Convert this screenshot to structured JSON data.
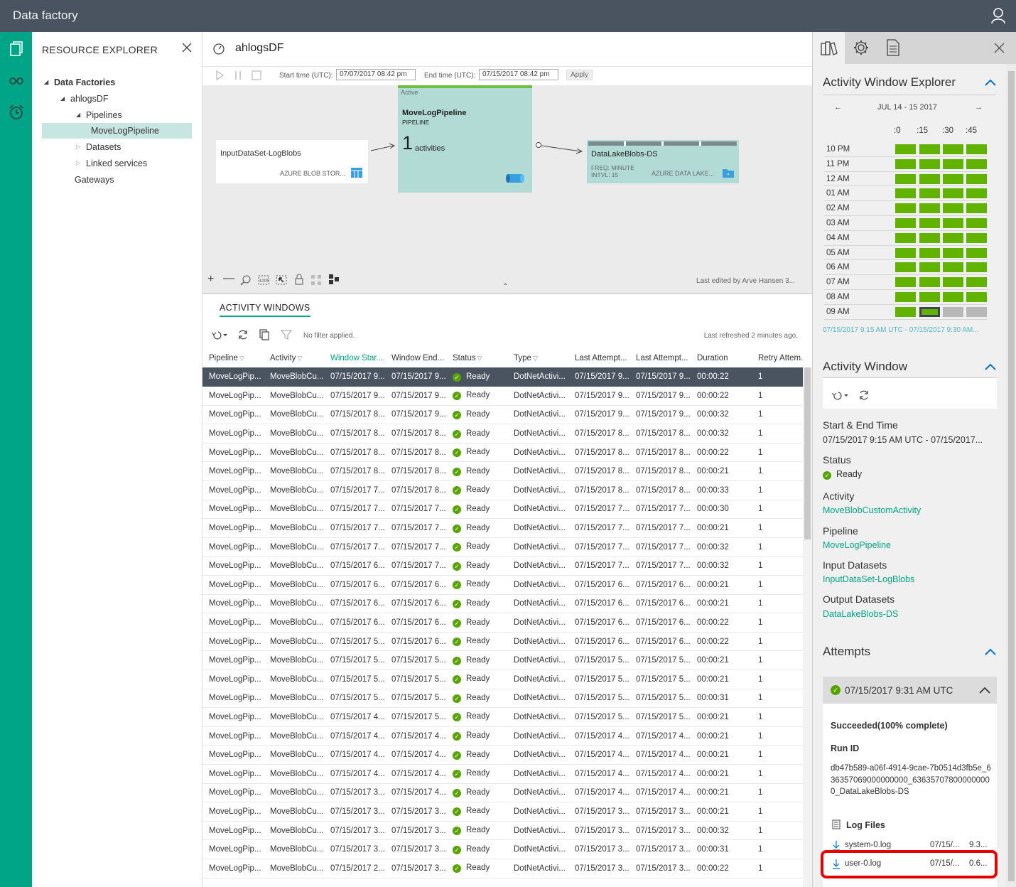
{
  "app": {
    "title": "Data factory"
  },
  "explorer": {
    "header": "RESOURCE EXPLORER",
    "tree": [
      {
        "label": "Data Factories",
        "bold": true
      },
      {
        "label": "ahlogsDF"
      },
      {
        "label": "Pipelines"
      },
      {
        "label": "MoveLogPipeline",
        "selected": true
      },
      {
        "label": "Datasets"
      },
      {
        "label": "Linked services"
      },
      {
        "label": "Gateways"
      }
    ]
  },
  "main": {
    "title": "ahlogsDF",
    "toolbar": {
      "start_label": "Start time (UTC):",
      "start_value": "07/07/2017 08:42 pm",
      "end_label": "End time (UTC):",
      "end_value": "07/15/2017 08:42 pm",
      "apply": "Apply"
    },
    "diagram": {
      "input_node": {
        "name": "InputDataSet-LogBlobs",
        "type": "AZURE BLOB STOR..."
      },
      "pipeline_node": {
        "state": "Active",
        "name": "MoveLogPipeline",
        "kind": "PIPELINE",
        "count": "1",
        "count_label": "activities"
      },
      "output_node": {
        "name": "DataLakeBlobs-DS",
        "freq": "FREQ: MINUTE",
        "intvl": "INTVL: 15",
        "type": "AZURE DATA LAKE..."
      }
    },
    "last_edited": "Last edited by Arve Hansen 3...",
    "activity_windows": {
      "title": "ACTIVITY WINDOWS",
      "filter_text": "No filter applied.",
      "refreshed": "Last refreshed 2 minutes ago.",
      "columns": [
        "Pipeline",
        "Activity",
        "Window Star...",
        "Window End...",
        "Status",
        "Type",
        "Last Attempt...",
        "Last Attempt...",
        "Duration",
        "Retry Attem..."
      ],
      "rows": [
        [
          "MoveLogPip...",
          "MoveBlobCu...",
          "07/15/2017 9...",
          "07/15/2017 9...",
          "Ready",
          "DotNetActivi...",
          "07/15/2017 9...",
          "07/15/2017 9...",
          "00:00:22",
          "1"
        ],
        [
          "MoveLogPip...",
          "MoveBlobCu...",
          "07/15/2017 9...",
          "07/15/2017 9...",
          "Ready",
          "DotNetActivi...",
          "07/15/2017 9...",
          "07/15/2017 9...",
          "00:00:22",
          "1"
        ],
        [
          "MoveLogPip...",
          "MoveBlobCu...",
          "07/15/2017 8...",
          "07/15/2017 9...",
          "Ready",
          "DotNetActivi...",
          "07/15/2017 9...",
          "07/15/2017 9...",
          "00:00:32",
          "1"
        ],
        [
          "MoveLogPip...",
          "MoveBlobCu...",
          "07/15/2017 8...",
          "07/15/2017 8...",
          "Ready",
          "DotNetActivi...",
          "07/15/2017 8...",
          "07/15/2017 8...",
          "00:00:32",
          "1"
        ],
        [
          "MoveLogPip...",
          "MoveBlobCu...",
          "07/15/2017 8...",
          "07/15/2017 8...",
          "Ready",
          "DotNetActivi...",
          "07/15/2017 8...",
          "07/15/2017 8...",
          "00:00:22",
          "1"
        ],
        [
          "MoveLogPip...",
          "MoveBlobCu...",
          "07/15/2017 8...",
          "07/15/2017 8...",
          "Ready",
          "DotNetActivi...",
          "07/15/2017 8...",
          "07/15/2017 8...",
          "00:00:21",
          "1"
        ],
        [
          "MoveLogPip...",
          "MoveBlobCu...",
          "07/15/2017 7...",
          "07/15/2017 8...",
          "Ready",
          "DotNetActivi...",
          "07/15/2017 8...",
          "07/15/2017 8...",
          "00:00:33",
          "1"
        ],
        [
          "MoveLogPip...",
          "MoveBlobCu...",
          "07/15/2017 7...",
          "07/15/2017 7...",
          "Ready",
          "DotNetActivi...",
          "07/15/2017 7...",
          "07/15/2017 7...",
          "00:00:30",
          "1"
        ],
        [
          "MoveLogPip...",
          "MoveBlobCu...",
          "07/15/2017 7...",
          "07/15/2017 7...",
          "Ready",
          "DotNetActivi...",
          "07/15/2017 7...",
          "07/15/2017 7...",
          "00:00:21",
          "1"
        ],
        [
          "MoveLogPip...",
          "MoveBlobCu...",
          "07/15/2017 7...",
          "07/15/2017 7...",
          "Ready",
          "DotNetActivi...",
          "07/15/2017 7...",
          "07/15/2017 7...",
          "00:00:32",
          "1"
        ],
        [
          "MoveLogPip...",
          "MoveBlobCu...",
          "07/15/2017 6...",
          "07/15/2017 7...",
          "Ready",
          "DotNetActivi...",
          "07/15/2017 7...",
          "07/15/2017 7...",
          "00:00:32",
          "1"
        ],
        [
          "MoveLogPip...",
          "MoveBlobCu...",
          "07/15/2017 6...",
          "07/15/2017 6...",
          "Ready",
          "DotNetActivi...",
          "07/15/2017 6...",
          "07/15/2017 6...",
          "00:00:21",
          "1"
        ],
        [
          "MoveLogPip...",
          "MoveBlobCu...",
          "07/15/2017 6...",
          "07/15/2017 6...",
          "Ready",
          "DotNetActivi...",
          "07/15/2017 6...",
          "07/15/2017 6...",
          "00:00:21",
          "1"
        ],
        [
          "MoveLogPip...",
          "MoveBlobCu...",
          "07/15/2017 6...",
          "07/15/2017 6...",
          "Ready",
          "DotNetActivi...",
          "07/15/2017 6...",
          "07/15/2017 6...",
          "00:00:22",
          "1"
        ],
        [
          "MoveLogPip...",
          "MoveBlobCu...",
          "07/15/2017 5...",
          "07/15/2017 6...",
          "Ready",
          "DotNetActivi...",
          "07/15/2017 6...",
          "07/15/2017 6...",
          "00:00:22",
          "1"
        ],
        [
          "MoveLogPip...",
          "MoveBlobCu...",
          "07/15/2017 5...",
          "07/15/2017 5...",
          "Ready",
          "DotNetActivi...",
          "07/15/2017 5...",
          "07/15/2017 5...",
          "00:00:21",
          "1"
        ],
        [
          "MoveLogPip...",
          "MoveBlobCu...",
          "07/15/2017 5...",
          "07/15/2017 5...",
          "Ready",
          "DotNetActivi...",
          "07/15/2017 5...",
          "07/15/2017 5...",
          "00:00:21",
          "1"
        ],
        [
          "MoveLogPip...",
          "MoveBlobCu...",
          "07/15/2017 5...",
          "07/15/2017 5...",
          "Ready",
          "DotNetActivi...",
          "07/15/2017 5...",
          "07/15/2017 5...",
          "00:00:31",
          "1"
        ],
        [
          "MoveLogPip...",
          "MoveBlobCu...",
          "07/15/2017 4...",
          "07/15/2017 5...",
          "Ready",
          "DotNetActivi...",
          "07/15/2017 5...",
          "07/15/2017 5...",
          "00:00:21",
          "1"
        ],
        [
          "MoveLogPip...",
          "MoveBlobCu...",
          "07/15/2017 4...",
          "07/15/2017 4...",
          "Ready",
          "DotNetActivi...",
          "07/15/2017 4...",
          "07/15/2017 4...",
          "00:00:21",
          "1"
        ],
        [
          "MoveLogPip...",
          "MoveBlobCu...",
          "07/15/2017 4...",
          "07/15/2017 4...",
          "Ready",
          "DotNetActivi...",
          "07/15/2017 4...",
          "07/15/2017 4...",
          "00:00:21",
          "1"
        ],
        [
          "MoveLogPip...",
          "MoveBlobCu...",
          "07/15/2017 4...",
          "07/15/2017 4...",
          "Ready",
          "DotNetActivi...",
          "07/15/2017 4...",
          "07/15/2017 4...",
          "00:00:21",
          "1"
        ],
        [
          "MoveLogPip...",
          "MoveBlobCu...",
          "07/15/2017 3...",
          "07/15/2017 4...",
          "Ready",
          "DotNetActivi...",
          "07/15/2017 4...",
          "07/15/2017 4...",
          "00:00:21",
          "1"
        ],
        [
          "MoveLogPip...",
          "MoveBlobCu...",
          "07/15/2017 3...",
          "07/15/2017 3...",
          "Ready",
          "DotNetActivi...",
          "07/15/2017 3...",
          "07/15/2017 3...",
          "00:00:21",
          "1"
        ],
        [
          "MoveLogPip...",
          "MoveBlobCu...",
          "07/15/2017 3...",
          "07/15/2017 3...",
          "Ready",
          "DotNetActivi...",
          "07/15/2017 3...",
          "07/15/2017 3...",
          "00:00:32",
          "1"
        ],
        [
          "MoveLogPip...",
          "MoveBlobCu...",
          "07/15/2017 3...",
          "07/15/2017 3...",
          "Ready",
          "DotNetActivi...",
          "07/15/2017 3...",
          "07/15/2017 3...",
          "00:00:31",
          "1"
        ],
        [
          "MoveLogPip...",
          "MoveBlobCu...",
          "07/15/2017 2...",
          "07/15/2017 3...",
          "Ready",
          "DotNetActivi...",
          "07/15/2017 3...",
          "07/15/2017 3...",
          "00:00:22",
          "1"
        ]
      ]
    }
  },
  "right": {
    "explorer_title": "Activity Window Explorer",
    "date_range": "JUL 14 - 15 2017",
    "minute_cols": [
      ":0",
      ":15",
      ":30",
      ":45"
    ],
    "hours": [
      {
        "label": "10 PM",
        "cells": [
          "ready",
          "ready",
          "ready",
          "ready"
        ]
      },
      {
        "label": "11 PM",
        "cells": [
          "ready",
          "ready",
          "ready",
          "ready"
        ]
      },
      {
        "label": "12 AM",
        "cells": [
          "ready",
          "ready",
          "ready",
          "ready"
        ]
      },
      {
        "label": "01 AM",
        "cells": [
          "ready",
          "ready",
          "ready",
          "ready"
        ]
      },
      {
        "label": "02 AM",
        "cells": [
          "ready",
          "ready",
          "ready",
          "ready"
        ]
      },
      {
        "label": "03 AM",
        "cells": [
          "ready",
          "ready",
          "ready",
          "ready"
        ]
      },
      {
        "label": "04 AM",
        "cells": [
          "ready",
          "ready",
          "ready",
          "ready"
        ]
      },
      {
        "label": "05 AM",
        "cells": [
          "ready",
          "ready",
          "ready",
          "ready"
        ]
      },
      {
        "label": "06 AM",
        "cells": [
          "ready",
          "ready",
          "ready",
          "ready"
        ]
      },
      {
        "label": "07 AM",
        "cells": [
          "ready",
          "ready",
          "ready",
          "ready"
        ]
      },
      {
        "label": "08 AM",
        "cells": [
          "ready",
          "ready",
          "ready",
          "ready"
        ]
      },
      {
        "label": "09 AM",
        "cells": [
          "ready",
          "selected",
          "pending",
          "pending"
        ]
      }
    ],
    "selected_range": "07/15/2017 9:15 AM UTC - 07/15/2017 9:30 AM...",
    "window_title": "Activity Window",
    "start_end_label": "Start & End Time",
    "start_end_value": "07/15/2017 9:15 AM UTC - 07/15/2017...",
    "status_label": "Status",
    "status_value": "Ready",
    "activity_label": "Activity",
    "activity_value": "MoveBlobCustomActivity",
    "pipeline_label": "Pipeline",
    "pipeline_value": "MoveLogPipeline",
    "input_label": "Input Datasets",
    "input_value": "InputDataSet-LogBlobs",
    "output_label": "Output Datasets",
    "output_value": "DataLakeBlobs-DS",
    "attempts_title": "Attempts",
    "attempt_time": "07/15/2017 9:31 AM UTC",
    "attempt_result": "Succeeded(100% complete)",
    "run_id_label": "Run ID",
    "run_id_value": "db47b589-a06f-4914-9cae-7b0514d3fb5e_636357069000000000_636357078000000000_DataLakeBlobs-DS",
    "log_files_label": "Log Files",
    "log_files": [
      {
        "name": "system-0.log",
        "date": "07/15/...",
        "size": "9.3..."
      },
      {
        "name": "user-0.log",
        "date": "07/15/...",
        "size": "0.6..."
      }
    ]
  },
  "colors": {
    "accent": "#00a486",
    "topbar": "#4a5360",
    "ready": "#62b300",
    "highlight": "#e60000"
  }
}
